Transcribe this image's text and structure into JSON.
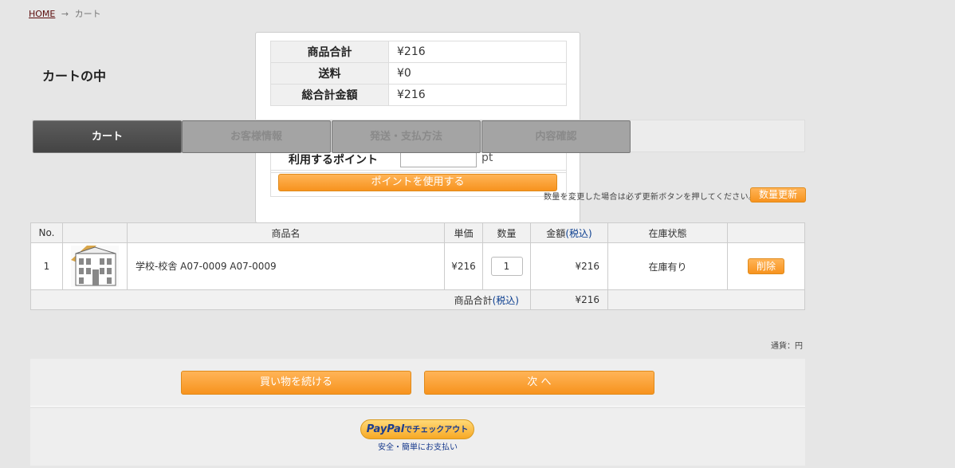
{
  "breadcrumb": {
    "home": "HOME",
    "arrow": "→",
    "current": "カート"
  },
  "page_title": "カートの中",
  "summary": {
    "rows": [
      {
        "label": "商品合計",
        "value": "¥216"
      },
      {
        "label": "送料",
        "value": "¥0"
      },
      {
        "label": "総合計金額",
        "value": "¥216"
      }
    ],
    "point_label": "利用するポイント",
    "point_value": "",
    "point_unit": "pt",
    "use_point_button": "ポイントを使用する"
  },
  "steps": [
    {
      "label": "カート",
      "active": true
    },
    {
      "label": "お客様情報",
      "active": false
    },
    {
      "label": "発送・支払方法",
      "active": false
    },
    {
      "label": "内容確認",
      "active": false
    }
  ],
  "qty_notice": "数量を変更した場合は必ず更新ボタンを押してください。",
  "qty_update_button": "数量更新",
  "cart": {
    "headers": {
      "no": "No.",
      "image": "",
      "name": "商品名",
      "unit_price": "単価",
      "qty": "数量",
      "amount": "金額",
      "amount_tax": "(税込)",
      "stock": "在庫状態",
      "action": ""
    },
    "items": [
      {
        "no": "1",
        "name": "学校-校舎 A07-0009 A07-0009",
        "unit_price": "¥216",
        "qty": "1",
        "amount": "¥216",
        "stock": "在庫有り",
        "delete": "削除"
      }
    ],
    "total_label": "商品合計",
    "total_tax": "(税込)",
    "total_value": "¥216"
  },
  "currency_note": "通貨：円",
  "buttons": {
    "continue": "買い物を続ける",
    "next": "次 へ"
  },
  "paypal": {
    "logo": "PayPal",
    "checkout": "でチェックアウト",
    "sub": "安全・簡単にお支払い"
  }
}
